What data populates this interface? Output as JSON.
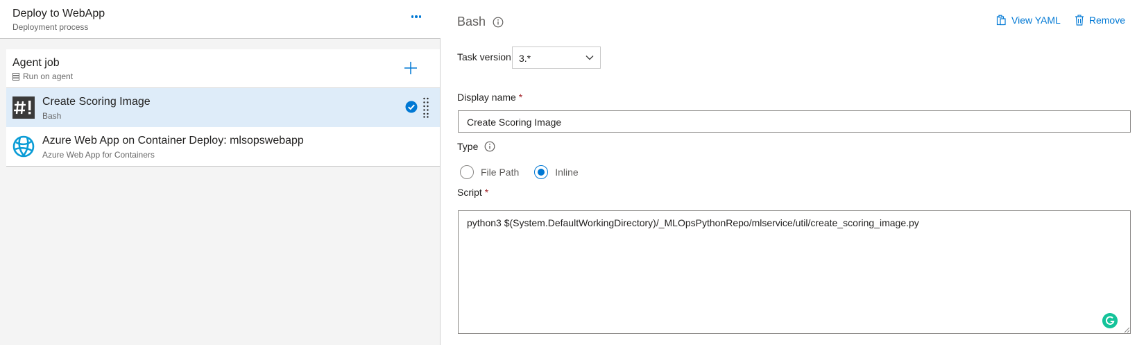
{
  "process": {
    "title": "Deploy to WebApp",
    "subtitle": "Deployment process",
    "more_icon": "ellipsis-icon"
  },
  "agent_job": {
    "title": "Agent job",
    "subtitle": "Run on agent",
    "add_icon": "plus-icon"
  },
  "tasks": [
    {
      "title": "Create Scoring Image",
      "subtitle": "Bash",
      "icon": "bash-icon",
      "selected": true
    },
    {
      "title": "Azure Web App on Container Deploy: mlsopswebapp",
      "subtitle": "Azure Web App for Containers",
      "icon": "azure-web-app-icon",
      "selected": false
    }
  ],
  "details": {
    "task_name": "Bash",
    "view_yaml_label": "View YAML",
    "remove_label": "Remove",
    "task_version_label": "Task version",
    "task_version_value": "3.*",
    "display_name_label": "Display name",
    "required_mark": "*",
    "display_name_value": "Create Scoring Image",
    "type_label": "Type",
    "type_options": [
      "File Path",
      "Inline"
    ],
    "type_selected": "Inline",
    "script_label": "Script",
    "script_value": "python3 $(System.DefaultWorkingDirectory)/_MLOpsPythonRepo/mlservice/util/create_scoring_image.py"
  },
  "colors": {
    "accent": "#0078d4",
    "selected_row": "#deecf9",
    "required": "#a4262c",
    "grammarly": "#15c39a"
  }
}
